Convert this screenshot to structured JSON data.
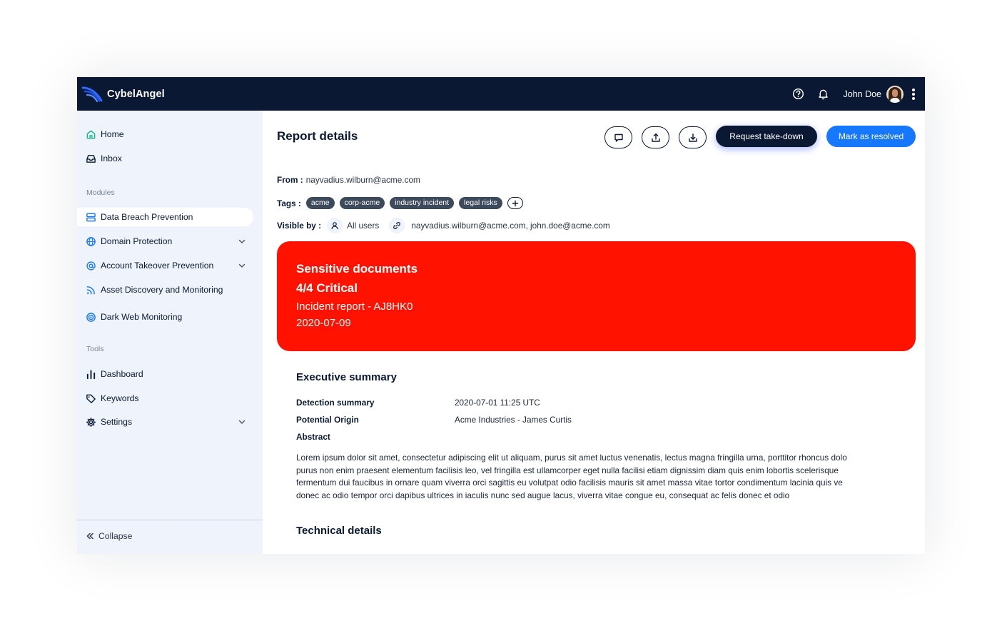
{
  "app": {
    "name": "CybelAngel"
  },
  "topbar": {
    "user_name": "John Doe",
    "help_icon": "question-circle-icon",
    "bell_icon": "bell-icon",
    "menu_icon": "kebab-icon"
  },
  "sidebar": {
    "items_top": [
      {
        "label": "Home",
        "icon": "home-icon"
      },
      {
        "label": "Inbox",
        "icon": "inbox-icon"
      }
    ],
    "modules_label": "Modules",
    "modules": [
      {
        "label": "Data Breach Prevention",
        "icon": "server-icon",
        "active": true
      },
      {
        "label": "Domain Protection",
        "icon": "globe-icon",
        "expandable": true
      },
      {
        "label": "Account Takeover Prevention",
        "icon": "at-icon",
        "expandable": true
      },
      {
        "label": "Asset Discovery and Monitoring",
        "icon": "rss-icon"
      },
      {
        "label": "Dark Web Monitoring",
        "icon": "target-icon"
      }
    ],
    "tools_label": "Tools",
    "tools": [
      {
        "label": "Dashboard",
        "icon": "bar-chart-icon"
      },
      {
        "label": "Keywords",
        "icon": "tag-icon"
      },
      {
        "label": "Settings",
        "icon": "gear-icon",
        "expandable": true
      }
    ],
    "collapse_label": "Collapse"
  },
  "report": {
    "title": "Report details",
    "actions": {
      "request_takedown": "Request take-down",
      "mark_resolved": "Mark as resolved"
    },
    "from_label": "From :",
    "from_value": "nayvadius.wilburn@acme.com",
    "tags_label": "Tags :",
    "tags": [
      "acme",
      "corp-acme",
      "industry incident",
      "legal risks"
    ],
    "visible_label": "Visible by :",
    "visible_all": "All users",
    "visible_emails": "nayvadius.wilburn@acme.com, john.doe@acme.com",
    "alert": {
      "category": "Sensitive documents",
      "severity": "4/4 Critical",
      "incident": "Incident report - AJ8HK0",
      "date": "2020-07-09",
      "color": "#ff1200"
    },
    "executive_summary": {
      "title": "Executive summary",
      "detection_label": "Detection summary",
      "detection_value": "2020-07-01 11:25 UTC",
      "origin_label": "Potential Origin",
      "origin_value": "Acme Industries - James Curtis",
      "abstract_label": "Abstract",
      "abstract_lines": [
        "Lorem ipsum dolor sit amet, consectetur adipiscing elit ut aliquam, purus sit amet luctus venenatis, lectus magna fringilla urna, porttitor rhoncus dolo",
        "purus non enim praesent elementum facilisis leo, vel fringilla est ullamcorper eget nulla facilisi etiam dignissim diam quis enim lobortis scelerisque",
        "fermentum dui faucibus in ornare quam viverra orci sagittis eu volutpat odio facilisis mauris sit amet massa vitae tortor condimentum lacinia quis ve",
        "donec ac odio tempor orci dapibus ultrices in iaculis nunc sed augue lacus, viverra vitae congue eu, consequat ac felis donec et odio"
      ]
    },
    "technical_details_title": "Technical details"
  },
  "colors": {
    "navy": "#0a1833",
    "accent_blue": "#1677ff",
    "critical_red": "#ff1200",
    "sidebar_bg": "#eef3fc"
  }
}
